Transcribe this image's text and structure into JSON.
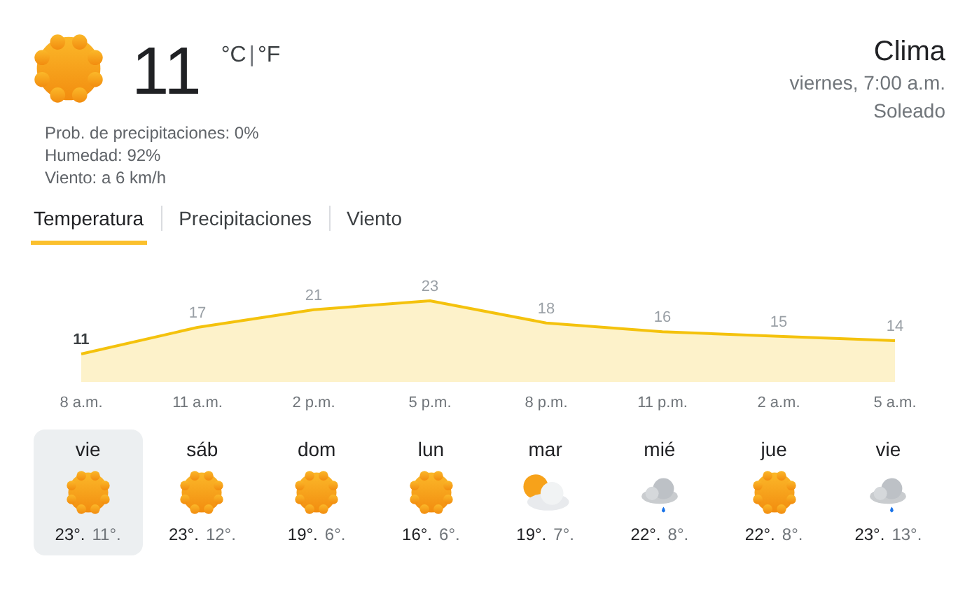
{
  "current": {
    "temperature": "11",
    "unit_celsius": "°C",
    "unit_separator": "|",
    "unit_fahrenheit": "°F",
    "details": [
      "Prob. de precipitaciones: 0%",
      "Humedad: 92%",
      "Viento: a 6 km/h"
    ]
  },
  "header": {
    "title": "Clima",
    "datetime": "viernes, 7:00 a.m.",
    "condition": "Soleado"
  },
  "tabs": [
    {
      "label": "Temperatura",
      "selected": true
    },
    {
      "label": "Precipitaciones",
      "selected": false
    },
    {
      "label": "Viento",
      "selected": false
    }
  ],
  "chart_data": {
    "type": "area",
    "categories": [
      "8 a.m.",
      "11 a.m.",
      "2 p.m.",
      "5 p.m.",
      "8 p.m.",
      "11 p.m.",
      "2 a.m.",
      "5 a.m."
    ],
    "series": [
      {
        "color": "#f4c20d",
        "values": [
          11,
          17,
          21,
          23,
          18,
          16,
          15,
          14
        ]
      }
    ],
    "data_labels": true
  },
  "days": [
    {
      "day": "vie",
      "kind": "sunny",
      "high": "23°.",
      "low": "11°.",
      "selected": true
    },
    {
      "day": "sáb",
      "kind": "sunny",
      "high": "23°.",
      "low": "12°.",
      "selected": false
    },
    {
      "day": "dom",
      "kind": "sunny",
      "high": "19°.",
      "low": "6°.",
      "selected": false
    },
    {
      "day": "lun",
      "kind": "sunny",
      "high": "16°.",
      "low": "6°.",
      "selected": false
    },
    {
      "day": "mar",
      "kind": "partly_cloudy",
      "high": "19°.",
      "low": "7°.",
      "selected": false
    },
    {
      "day": "mié",
      "kind": "rain",
      "high": "22°.",
      "low": "8°.",
      "selected": false
    },
    {
      "day": "jue",
      "kind": "sunny",
      "high": "22°.",
      "low": "8°.",
      "selected": false
    },
    {
      "day": "vie",
      "kind": "rain",
      "high": "23°.",
      "low": "13°.",
      "selected": false
    }
  ]
}
